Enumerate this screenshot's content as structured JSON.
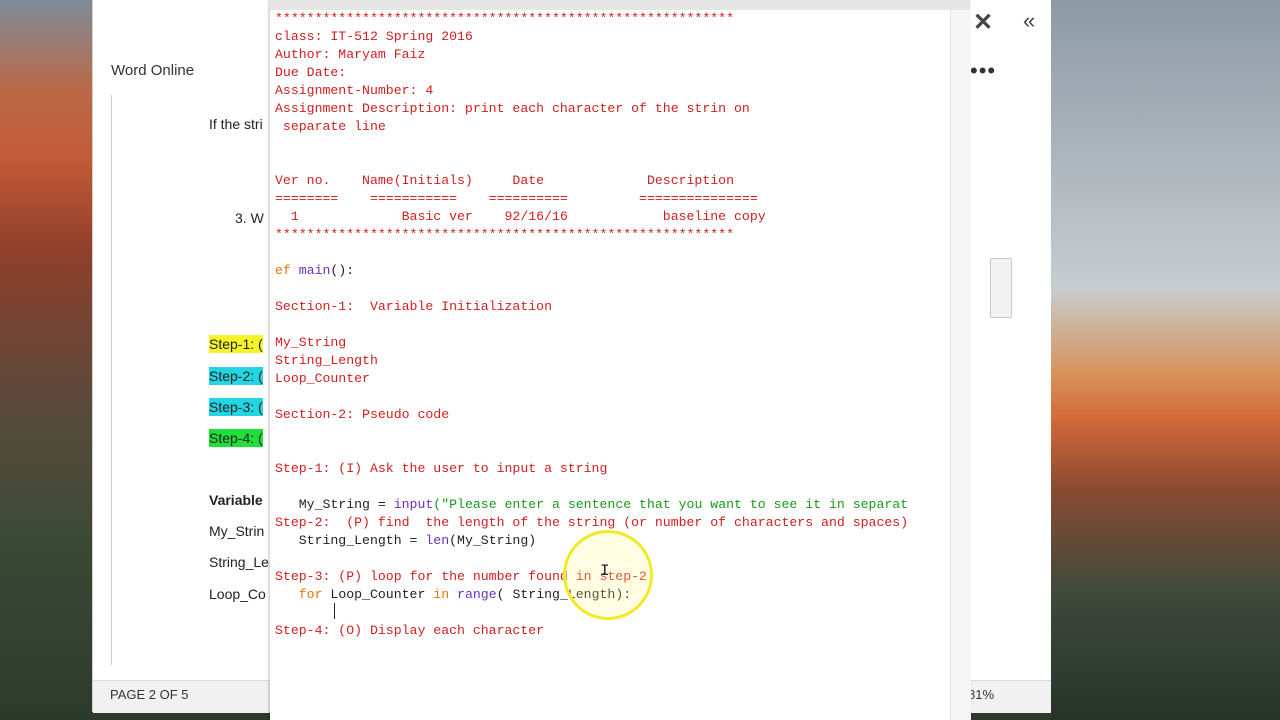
{
  "word": {
    "app_title": "Word Online",
    "page_indicator": "PAGE 2 OF 5",
    "zoom": "81%",
    "fragments": {
      "line1": "If the stri",
      "list_item": "3.   W",
      "step1": "Step-1: (",
      "step2": "Step-2:  (",
      "step3": "Step-3: (",
      "step4": "Step-4: (",
      "variables": "Variable",
      "my_string": "My_Strin",
      "string_length": "String_Le",
      "loop_counter": "Loop_Co"
    }
  },
  "editor": {
    "lines": {
      "l01": "**********************************************************",
      "l02": "class: IT-512 Spring 2016",
      "l03": "Author: Maryam Faiz",
      "l04": "Due Date:",
      "l05": "Assignment-Number: 4",
      "l06": "Assignment Description: print each character of the strin on",
      "l07": " separate line",
      "l10": "Ver no.    Name(Initials)     Date             Description",
      "l11": "========    ===========    ==========         ===============",
      "l12": "  1             Basic ver    92/16/16            baseline copy",
      "l13": "**********************************************************",
      "l15_kw": "ef",
      "l15_fn": "main",
      "l15_rest": "():",
      "l17": "Section-1:  Variable Initialization",
      "l19": "My_String",
      "l20": "String_Length",
      "l21": "Loop_Counter",
      "l23": "Section-2: Pseudo code",
      "l26": "Step-1: (I) Ask the user to input a string",
      "l28_pre": "   My_String = ",
      "l28_fn": "input",
      "l28_str": "(\"Please enter a sentence that you want to see it in separat",
      "l29": "Step-2:  (P) find  the length of the string (or number of characters and spaces)",
      "l30_pre": "   String_Length = ",
      "l30_fn": "len",
      "l30_rest": "(My_String)",
      "l32": "Step-3: (P) loop for the number found in step-2",
      "l33_indent": "   ",
      "l33_kw1": "for",
      "l33_mid": " Loop_Counter ",
      "l33_kw2": "in",
      "l33_sp": " ",
      "l33_fn": "range",
      "l33_rest": "( String_Length):",
      "l35": "Step-4: (O) Display each character"
    }
  },
  "icons": {
    "close": "✕",
    "collapse": "«",
    "more": "•••"
  }
}
